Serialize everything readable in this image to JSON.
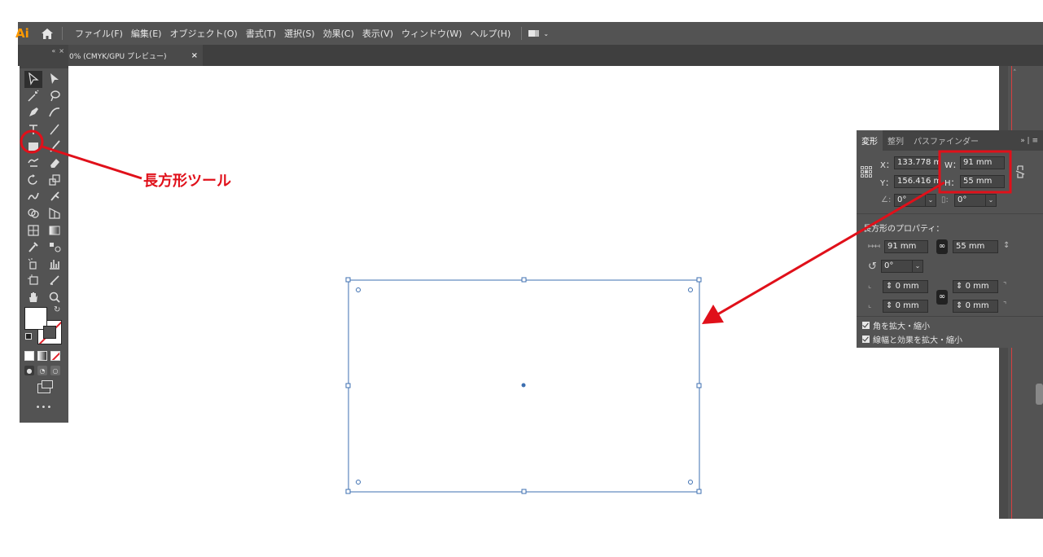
{
  "app": {
    "logo": "Ai"
  },
  "menu": [
    "ファイル(F)",
    "編集(E)",
    "オブジェクト(O)",
    "書式(T)",
    "選択(S)",
    "効果(C)",
    "表示(V)",
    "ウィンドウ(W)",
    "ヘルプ(H)"
  ],
  "doc_tab": {
    "label": "0% (CMYK/GPU プレビュー)",
    "close": "×"
  },
  "annotation": {
    "callout": "長方形ツール",
    "color": "#e0101a"
  },
  "panel": {
    "tabs": [
      "変形",
      "整列",
      "パスファインダー"
    ],
    "x_label": "X：",
    "x_value": "133.778 m",
    "y_label": "Y：",
    "y_value": "156.416 m",
    "w_label": "W：",
    "w_value": "91 mm",
    "h_label": "H：",
    "h_value": "55 mm",
    "angle_value": "0°",
    "shear_value": "0°",
    "rect_props_title": "長方形のプロパティ：",
    "rect_w": "91 mm",
    "rect_h": "55 mm",
    "rect_rotate": "0°",
    "corner_tl": "0 mm",
    "corner_tr": "0 mm",
    "corner_bl": "0 mm",
    "corner_br": "0 mm",
    "chk_scale_corners": "角を拡大・縮小",
    "chk_scale_strokes": "線幅と効果を拡大・縮小"
  },
  "colors": {
    "ui_dark": "#535353",
    "accent_red": "#e0101a",
    "selection_blue": "#3d6fb0"
  }
}
